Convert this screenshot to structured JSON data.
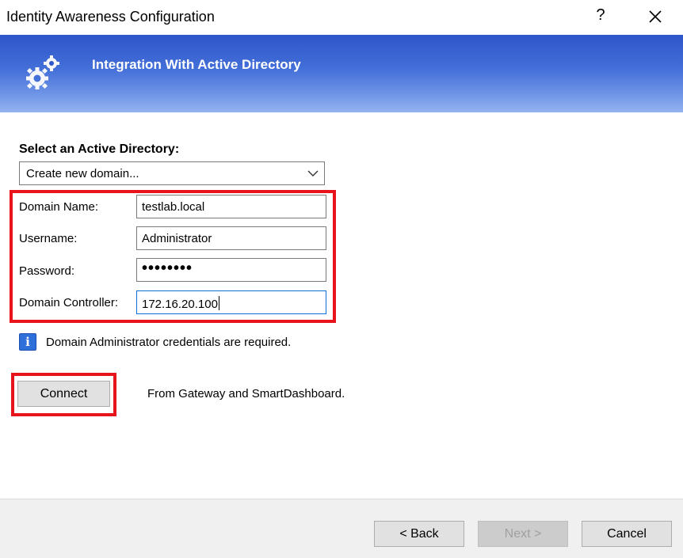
{
  "window": {
    "title": "Identity Awareness Configuration",
    "help_label": "?",
    "close_icon": "close-icon"
  },
  "banner": {
    "title": "Integration With Active Directory",
    "icon": "gears-icon",
    "gradient_top": "#2e55c9",
    "gradient_bottom": "#93b2ef"
  },
  "form": {
    "select_label": "Select an Active Directory:",
    "directory_select": {
      "selected": "Create new domain..."
    },
    "fields": {
      "domain_name": {
        "label": "Domain Name:",
        "value": "testlab.local"
      },
      "username": {
        "label": "Username:",
        "value": "Administrator"
      },
      "password": {
        "label": "Password:",
        "value": "••••••••"
      },
      "domain_controller": {
        "label": "Domain Controller:",
        "value": "172.16.20.100"
      }
    },
    "info": {
      "icon": "info-icon",
      "glyph": "i",
      "text": "Domain Administrator credentials are required."
    },
    "connect_button": "Connect",
    "connect_note": "From Gateway and SmartDashboard."
  },
  "highlight_color": "#e8141b",
  "footer": {
    "back": "< Back",
    "next": "Next >",
    "cancel": "Cancel"
  }
}
